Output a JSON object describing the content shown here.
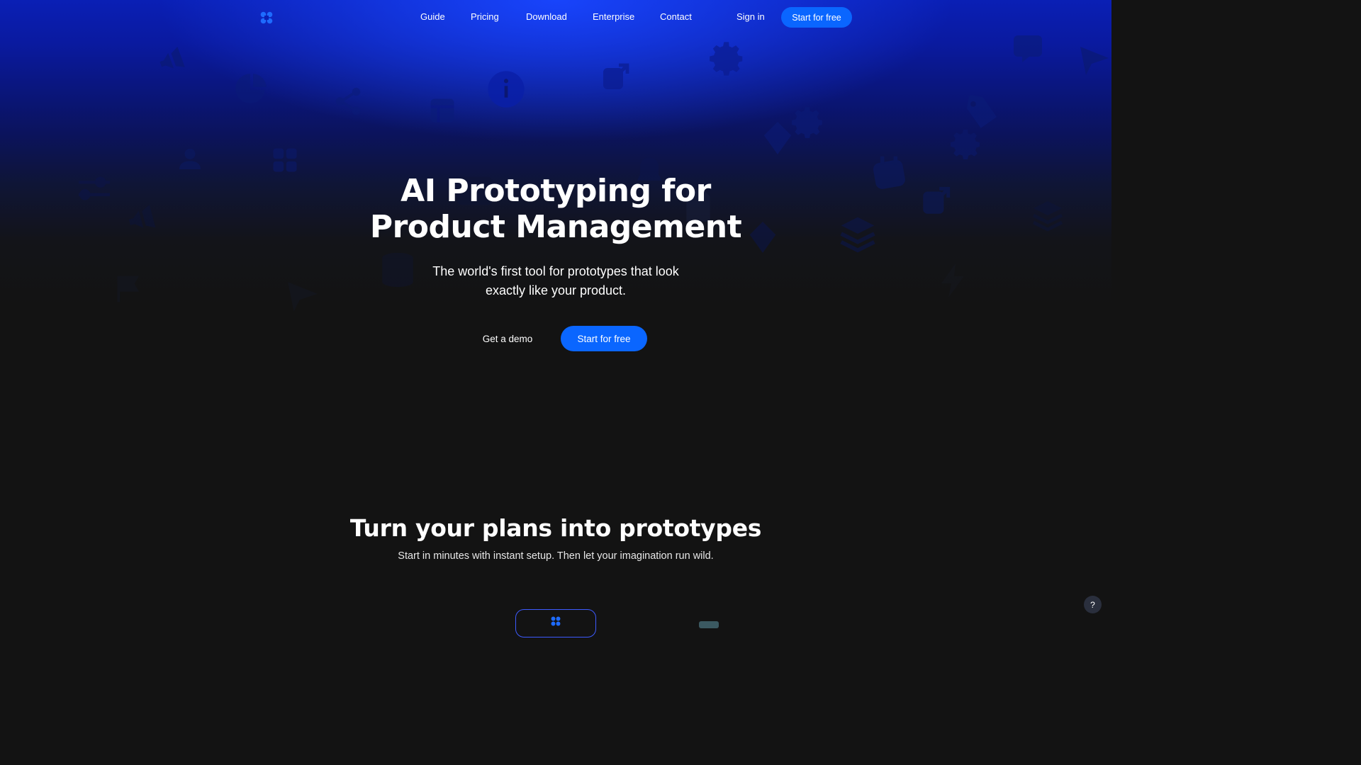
{
  "brand": {
    "accent": "#0a66ff",
    "logo_icon": "four-petal-logo-icon"
  },
  "nav": {
    "links": [
      {
        "label": "Guide"
      },
      {
        "label": "Pricing"
      },
      {
        "label": "Download"
      },
      {
        "label": "Enterprise"
      },
      {
        "label": "Contact"
      }
    ],
    "sign_in": "Sign in",
    "cta": "Start for free"
  },
  "hero": {
    "title_line1": "AI Prototyping for",
    "title_line2": "Product Management",
    "subtitle": "The world's first tool for prototypes that look exactly like your product.",
    "demo_label": "Get a demo",
    "cta_label": "Start for free",
    "background_icons": [
      "megaphone-icon",
      "pie-chart-icon",
      "share-icon",
      "layout-icon",
      "info-icon",
      "external-link-icon",
      "gear-icon",
      "user-icon",
      "grid-icon",
      "sliders-icon",
      "diamond-icon",
      "tag-icon",
      "calendar-icon",
      "layers-icon",
      "database-icon",
      "flag-icon",
      "send-icon",
      "lightning-icon",
      "document-icon",
      "bell-icon",
      "chat-bubble-icon"
    ]
  },
  "section": {
    "title": "Turn your plans into prototypes",
    "subtitle": "Start in minutes with instant setup. Then let your imagination run wild."
  },
  "help": {
    "label": "?"
  }
}
